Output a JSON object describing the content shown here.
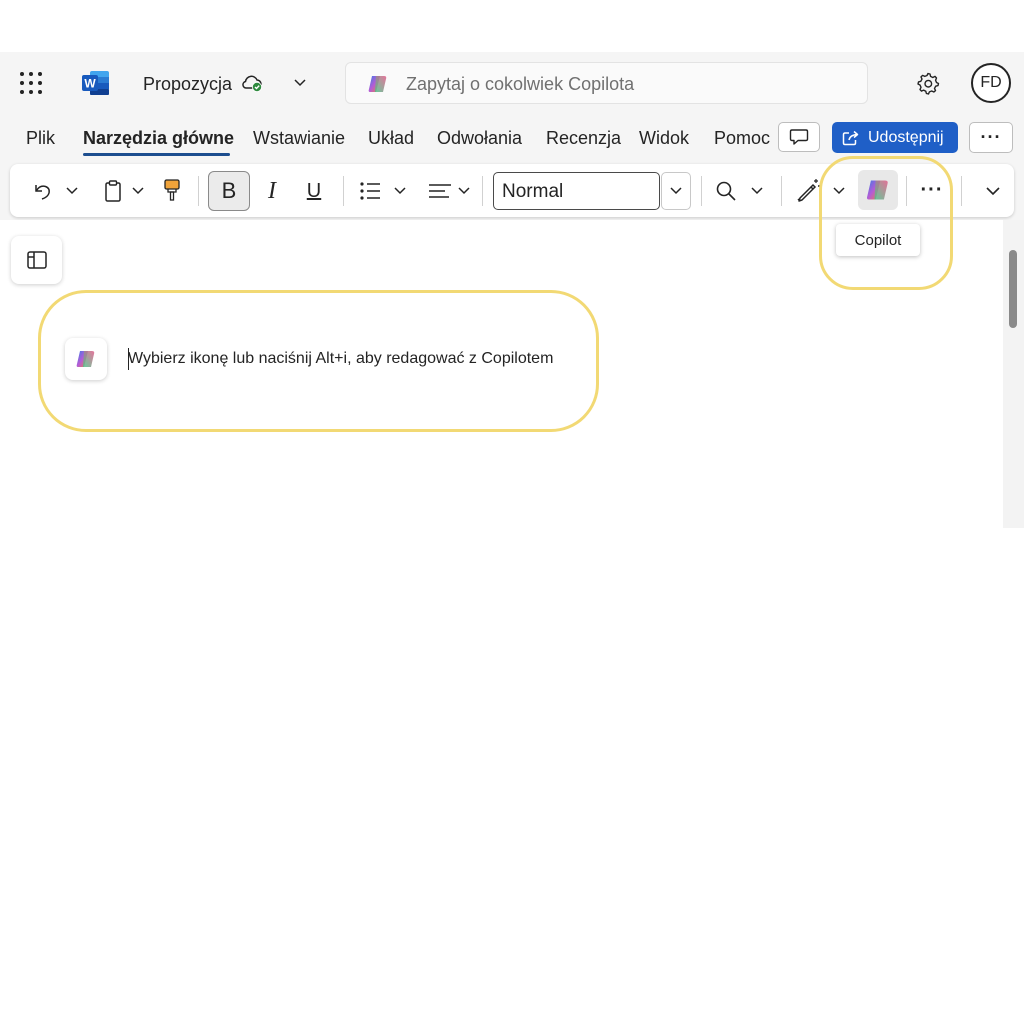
{
  "titlebar": {
    "app_name_logo": "W",
    "document_title": "Propozycja",
    "search_placeholder": "Zapytaj o cokolwiek Copilota",
    "user_initials": "FD"
  },
  "ribbon": {
    "tabs": [
      {
        "label": "Plik",
        "active": false
      },
      {
        "label": "Narzędzia główne",
        "active": true
      },
      {
        "label": "Wstawianie",
        "active": false
      },
      {
        "label": "Układ",
        "active": false
      },
      {
        "label": "Odwołania",
        "active": false
      },
      {
        "label": "Recenzja",
        "active": false
      },
      {
        "label": "Widok",
        "active": false
      },
      {
        "label": "Pomoc",
        "active": false
      }
    ],
    "share_label": "Udostępnij",
    "more_label": "···"
  },
  "toolbar": {
    "bold_label": "B",
    "italic_label": "I",
    "underline_label": "U",
    "style_value": "Normal",
    "more_label": "···",
    "copilot_tooltip": "Copilot"
  },
  "document": {
    "copilot_prompt": "Wybierz ikonę lub naciśnij Alt+i, aby redagować z Copilotem"
  },
  "colors": {
    "accent": "#1f5fc7",
    "tab_underline": "#1d4e8f",
    "highlight": "#f2d974",
    "word_blue": "#185abd"
  }
}
